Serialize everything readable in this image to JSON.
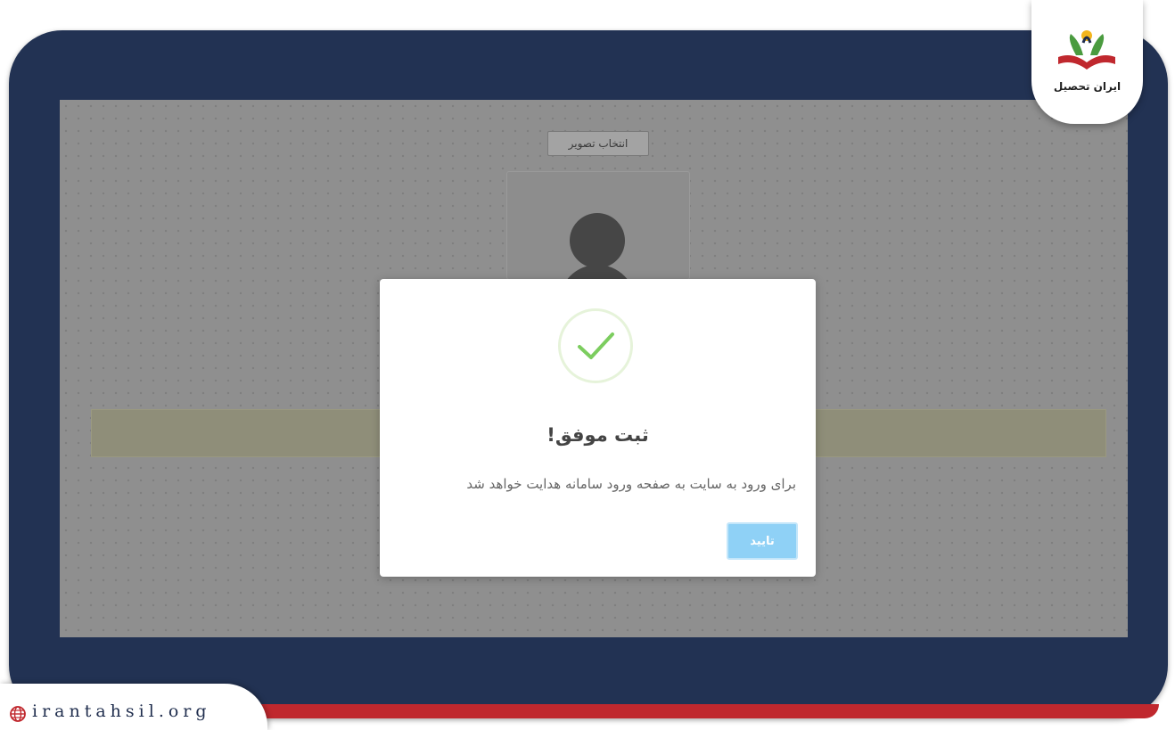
{
  "background_page": {
    "select_image_label": "انتخاب تصویر"
  },
  "modal": {
    "title": "ثبت موفق!",
    "message": "برای ورود به سایت به صفحه ورود سامانه هدایت خواهد شد",
    "confirm_label": "تایید"
  },
  "branding": {
    "logo_text": "ایران تحصیل",
    "website": "irantahsil.org"
  },
  "colors": {
    "frame": "#223253",
    "accent_red": "#c0282e",
    "success_green": "#7ccd5f",
    "confirm_button": "#8fd1f6"
  }
}
